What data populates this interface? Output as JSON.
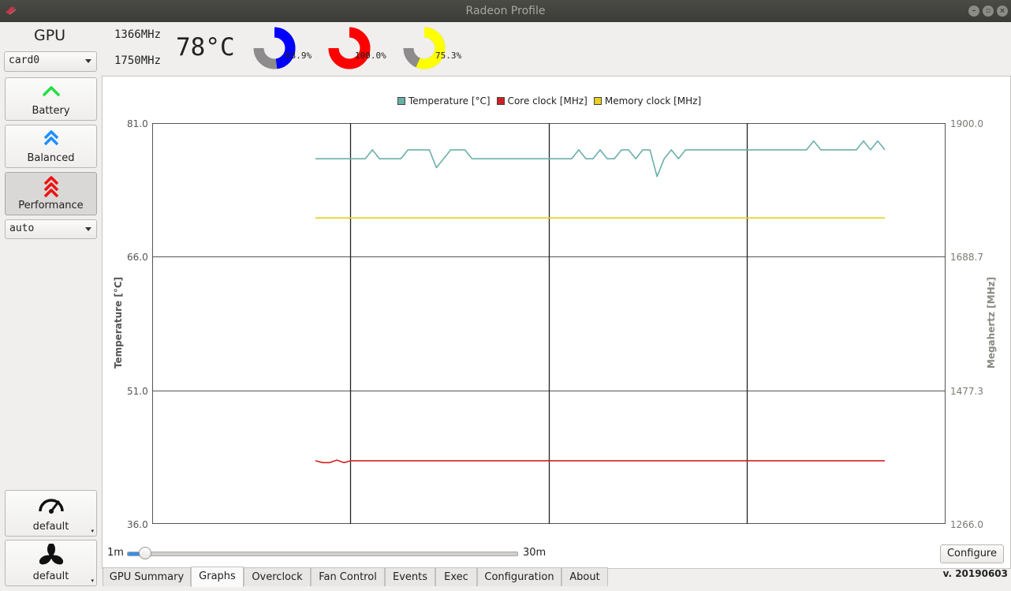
{
  "window": {
    "title": "Radeon Profile"
  },
  "sidebar": {
    "gpu_label": "GPU",
    "card_select": "card0",
    "profiles": [
      {
        "label": "Battery",
        "icon": "chevron-up-icon",
        "color": "#22dd44"
      },
      {
        "label": "Balanced",
        "icon": "double-chevron-up-icon",
        "color": "#1e90ff"
      },
      {
        "label": "Performance",
        "icon": "triple-chevron-up-icon",
        "color": "#ee1111"
      }
    ],
    "active_profile": "Performance",
    "power_level_select": "auto",
    "clock_profile_label": "default",
    "fan_profile_label": "default"
  },
  "header": {
    "core_clock": "1366MHz",
    "memory_clock": "1750MHz",
    "temperature": "78°C",
    "gauges": [
      {
        "value": 63.9,
        "label": "63.9%",
        "color": "#0000ff"
      },
      {
        "value": 100.0,
        "label": "100.0%",
        "color": "#ff0000"
      },
      {
        "value": 75.3,
        "label": "75.3%",
        "color": "#ffff00"
      }
    ]
  },
  "chart_data": {
    "type": "line",
    "legend": [
      {
        "name": "Temperature [°C]",
        "color": "#6ab0a8"
      },
      {
        "name": "Core clock [MHz]",
        "color": "#d02020"
      },
      {
        "name": "Memory clock [MHz]",
        "color": "#e8d020"
      }
    ],
    "legend_position": "top-center",
    "y_left": {
      "label": "Temperature [°C]",
      "ticks": [
        "81.0",
        "66.0",
        "51.0",
        "36.0"
      ],
      "range": [
        36.0,
        81.0
      ]
    },
    "y_right": {
      "label": "Megahertz [MHz]",
      "ticks": [
        "1900.0",
        "1688.7",
        "1477.3",
        "1266.0"
      ],
      "range": [
        1266.0,
        1900.0
      ]
    },
    "x": [
      0,
      1,
      2,
      3,
      4,
      5,
      6,
      7,
      8,
      9,
      10,
      11,
      12,
      13,
      14,
      15,
      16,
      17,
      18,
      19,
      20,
      21,
      22,
      23,
      24,
      25,
      26,
      27,
      28,
      29,
      30,
      31,
      32,
      33,
      34,
      35,
      36,
      37,
      38,
      39,
      40,
      41,
      42,
      43,
      44,
      45,
      46,
      47,
      48,
      49,
      50,
      51,
      52,
      53,
      54,
      55,
      56,
      57,
      58,
      59,
      60,
      61,
      62,
      63,
      64,
      65,
      66,
      67,
      68,
      69,
      70,
      71,
      72,
      73,
      74,
      75,
      76,
      77,
      78,
      79,
      80
    ],
    "series": [
      {
        "name": "Temperature [°C]",
        "axis": "left",
        "values": [
          77,
          77,
          77,
          77,
          77,
          77,
          77,
          77,
          78,
          77,
          77,
          77,
          77,
          78,
          78,
          78,
          78,
          76,
          77,
          78,
          78,
          78,
          77,
          77,
          77,
          77,
          77,
          77,
          77,
          77,
          77,
          77,
          77,
          77,
          77,
          77,
          77,
          78,
          77,
          77,
          78,
          77,
          77,
          78,
          78,
          77,
          78,
          78,
          75,
          77,
          78,
          77,
          78,
          78,
          78,
          78,
          78,
          78,
          78,
          78,
          78,
          78,
          78,
          78,
          78,
          78,
          78,
          78,
          78,
          78,
          79,
          78,
          78,
          78,
          78,
          78,
          78,
          79,
          78,
          79,
          78
        ]
      },
      {
        "name": "Core clock [MHz]",
        "axis": "right",
        "values": [
          1366,
          1363,
          1363,
          1367,
          1363,
          1366,
          1366,
          1366,
          1366,
          1366,
          1366,
          1366,
          1366,
          1366,
          1366,
          1366,
          1366,
          1366,
          1366,
          1366,
          1366,
          1366,
          1366,
          1366,
          1366,
          1366,
          1366,
          1366,
          1366,
          1366,
          1366,
          1366,
          1366,
          1366,
          1366,
          1366,
          1366,
          1366,
          1366,
          1366,
          1366,
          1366,
          1366,
          1366,
          1366,
          1366,
          1366,
          1366,
          1366,
          1366,
          1366,
          1366,
          1366,
          1366,
          1366,
          1366,
          1366,
          1366,
          1366,
          1366,
          1366,
          1366,
          1366,
          1366,
          1366,
          1366,
          1366,
          1366,
          1366,
          1366,
          1366,
          1366,
          1366,
          1366,
          1366,
          1366,
          1366,
          1366,
          1366,
          1366,
          1366
        ]
      },
      {
        "name": "Memory clock [MHz]",
        "axis": "right",
        "values": [
          1750,
          1750,
          1750,
          1750,
          1750,
          1750,
          1750,
          1750,
          1750,
          1750,
          1750,
          1750,
          1750,
          1750,
          1750,
          1750,
          1750,
          1750,
          1750,
          1750,
          1750,
          1750,
          1750,
          1750,
          1750,
          1750,
          1750,
          1750,
          1750,
          1750,
          1750,
          1750,
          1750,
          1750,
          1750,
          1750,
          1750,
          1750,
          1750,
          1750,
          1750,
          1750,
          1750,
          1750,
          1750,
          1750,
          1750,
          1750,
          1750,
          1750,
          1750,
          1750,
          1750,
          1750,
          1750,
          1750,
          1750,
          1750,
          1750,
          1750,
          1750,
          1750,
          1750,
          1750,
          1750,
          1750,
          1750,
          1750,
          1750,
          1750,
          1750,
          1750,
          1750,
          1750,
          1750,
          1750,
          1750,
          1750,
          1750,
          1750,
          1750
        ]
      }
    ],
    "grid": true
  },
  "time_slider": {
    "min_label": "1m",
    "max_label": "30m",
    "value": 1
  },
  "configure_button": "Configure",
  "tabs": [
    "GPU Summary",
    "Graphs",
    "Overclock",
    "Fan Control",
    "Events",
    "Exec",
    "Configuration",
    "About"
  ],
  "selected_tab": "Graphs",
  "version": "v. 20190603"
}
